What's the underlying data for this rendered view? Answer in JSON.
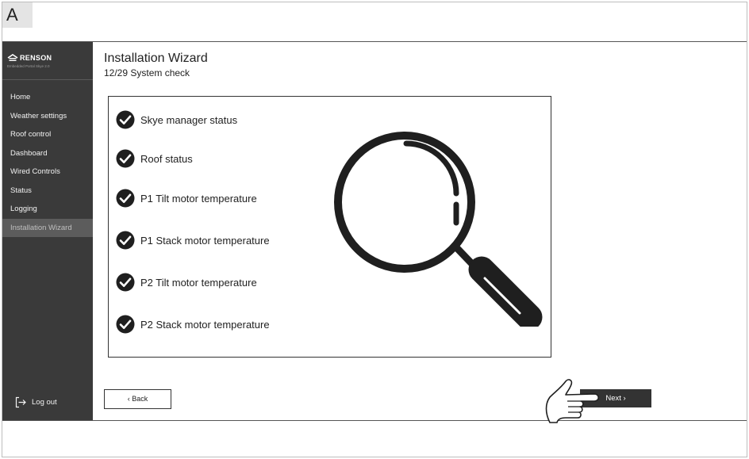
{
  "corner_label": "A",
  "brand": {
    "name": "RENSON",
    "subtitle": "Embedded Portal Skye 2.0"
  },
  "sidebar": {
    "items": [
      {
        "label": "Home",
        "active": false
      },
      {
        "label": "Weather settings",
        "active": false
      },
      {
        "label": "Roof control",
        "active": false
      },
      {
        "label": "Dashboard",
        "active": false
      },
      {
        "label": "Wired Controls",
        "active": false
      },
      {
        "label": "Status",
        "active": false
      },
      {
        "label": "Logging",
        "active": false
      },
      {
        "label": "Installation Wizard",
        "active": true
      }
    ],
    "logout_label": "Log out"
  },
  "page": {
    "title": "Installation Wizard",
    "subtitle": "12/29 System check"
  },
  "checks": [
    {
      "label": "Skye manager status",
      "checked": true
    },
    {
      "label": "Roof status",
      "checked": true
    },
    {
      "label": "P1 Tilt motor temperature",
      "checked": true
    },
    {
      "label": "P1 Stack motor temperature",
      "checked": true
    },
    {
      "label": "P2 Tilt motor temperature",
      "checked": true
    },
    {
      "label": "P2 Stack motor temperature",
      "checked": true
    }
  ],
  "buttons": {
    "back": "‹ Back",
    "next": "Next ›"
  },
  "icons": {
    "checkbox": "checkmark-circle-icon",
    "magnifier": "magnifying-glass-icon",
    "pointer": "pointing-hand-icon",
    "logout": "logout-icon"
  },
  "colors": {
    "sidebar_bg": "#3a3a3a",
    "active_item_bg": "#5c5c5c",
    "button_dark": "#333333"
  }
}
